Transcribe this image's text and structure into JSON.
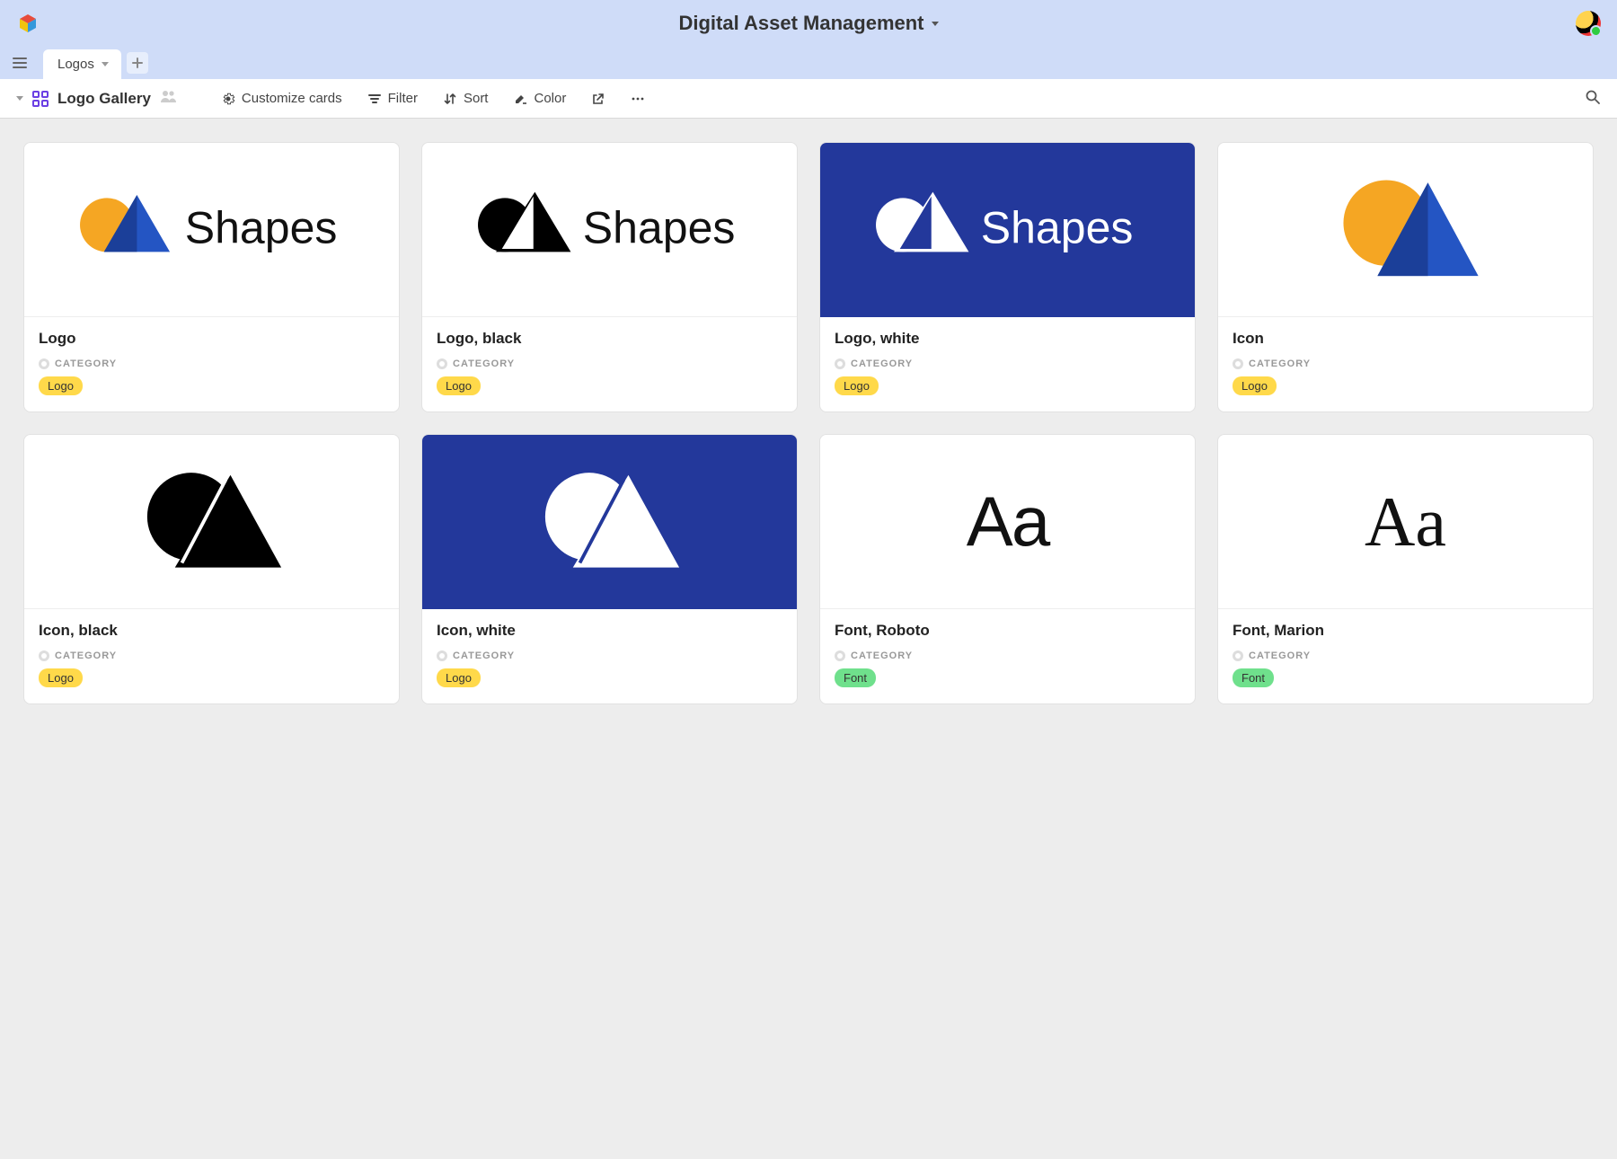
{
  "header": {
    "workspace_title": "Digital Asset Management"
  },
  "tabs": {
    "active": "Logos"
  },
  "toolbar": {
    "view_name": "Logo Gallery",
    "customize": "Customize cards",
    "filter": "Filter",
    "sort": "Sort",
    "color": "Color"
  },
  "category_label": "CATEGORY",
  "tags": {
    "logo": "Logo",
    "font": "Font"
  },
  "cards": [
    {
      "title": "Logo",
      "tag": "logo",
      "thumb": "logo_color"
    },
    {
      "title": "Logo, black",
      "tag": "logo",
      "thumb": "logo_black"
    },
    {
      "title": "Logo, white",
      "tag": "logo",
      "thumb": "logo_white"
    },
    {
      "title": "Icon",
      "tag": "logo",
      "thumb": "icon_color"
    },
    {
      "title": "Icon, black",
      "tag": "logo",
      "thumb": "icon_black"
    },
    {
      "title": "Icon, white",
      "tag": "logo",
      "thumb": "icon_white"
    },
    {
      "title": "Font, Roboto",
      "tag": "font",
      "thumb": "font_sans"
    },
    {
      "title": "Font, Marion",
      "tag": "font",
      "thumb": "font_serif"
    }
  ]
}
